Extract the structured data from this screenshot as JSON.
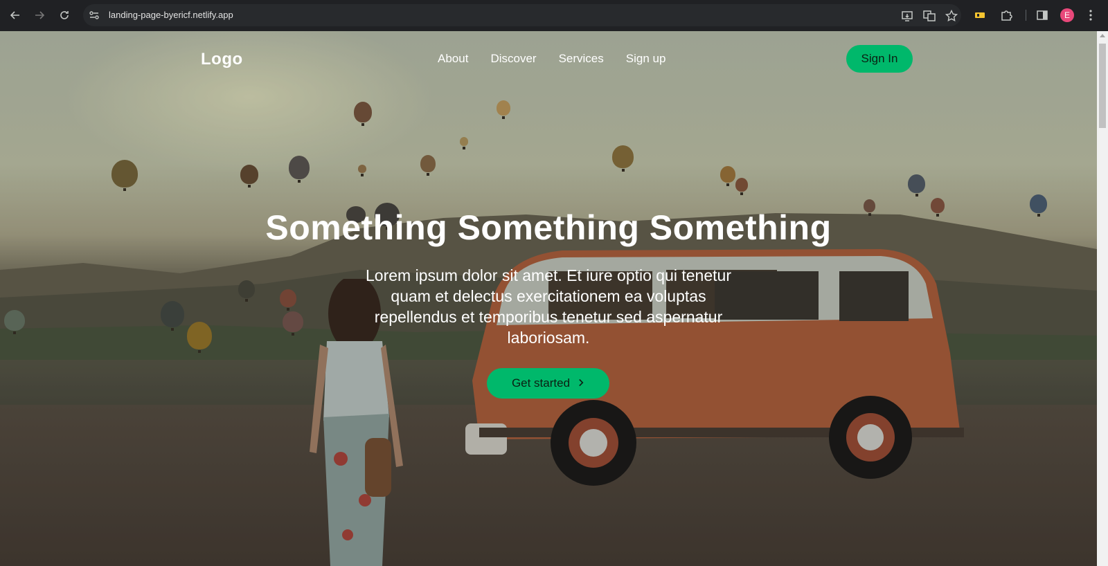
{
  "browser": {
    "url": "landing-page-byericf.netlify.app",
    "avatar_letter": "E"
  },
  "nav": {
    "logo": "Logo",
    "links": [
      "About",
      "Discover",
      "Services",
      "Sign up"
    ],
    "sign_in": "Sign In"
  },
  "hero": {
    "title": "Something Something Something",
    "subtitle": "Lorem ipsum dolor sit amet. Et iure optio qui tenetur quam et delectus exercitationem ea voluptas repellendus et temporibus tenetur sed aspernatur laboriosam.",
    "cta": "Get started",
    "cta_icon": "chevron-right-icon"
  },
  "colors": {
    "accent": "#00b86b",
    "browser_chrome": "#202124"
  }
}
